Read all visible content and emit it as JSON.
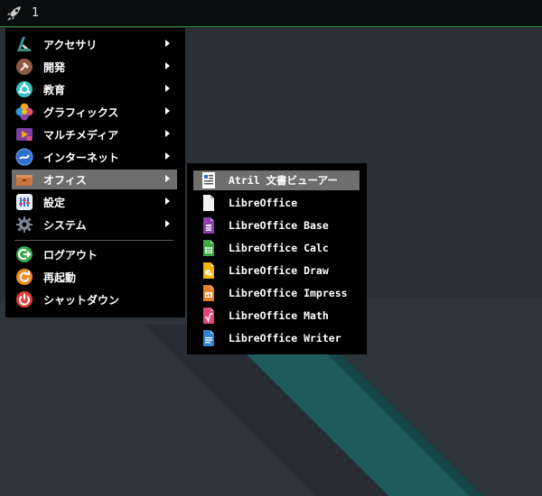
{
  "panel": {
    "workspace": "1"
  },
  "main_menu": {
    "items": [
      {
        "label": "アクセサリ",
        "icon": "accessories-icon",
        "submenu": true
      },
      {
        "label": "開発",
        "icon": "development-icon",
        "submenu": true
      },
      {
        "label": "教育",
        "icon": "education-icon",
        "submenu": true
      },
      {
        "label": "グラフィックス",
        "icon": "graphics-icon",
        "submenu": true
      },
      {
        "label": "マルチメディア",
        "icon": "multimedia-icon",
        "submenu": true
      },
      {
        "label": "インターネット",
        "icon": "internet-icon",
        "submenu": true
      },
      {
        "label": "オフィス",
        "icon": "office-icon",
        "submenu": true,
        "active": true
      },
      {
        "label": "設定",
        "icon": "settings-icon",
        "submenu": true
      },
      {
        "label": "システム",
        "icon": "system-icon",
        "submenu": true
      }
    ],
    "session": [
      {
        "label": "ログアウト",
        "icon": "logout-icon"
      },
      {
        "label": "再起動",
        "icon": "reboot-icon"
      },
      {
        "label": "シャットダウン",
        "icon": "shutdown-icon"
      }
    ]
  },
  "office_menu": {
    "items": [
      {
        "label": "Atril 文書ビューアー",
        "icon": "document-viewer-icon",
        "active": true
      },
      {
        "label": "LibreOffice",
        "icon": "libreoffice-icon"
      },
      {
        "label": "LibreOffice Base",
        "icon": "libreoffice-base-icon"
      },
      {
        "label": "LibreOffice Calc",
        "icon": "libreoffice-calc-icon"
      },
      {
        "label": "LibreOffice Draw",
        "icon": "libreoffice-draw-icon"
      },
      {
        "label": "LibreOffice Impress",
        "icon": "libreoffice-impress-icon"
      },
      {
        "label": "LibreOffice Math",
        "icon": "libreoffice-math-icon"
      },
      {
        "label": "LibreOffice Writer",
        "icon": "libreoffice-writer-icon"
      }
    ]
  },
  "colors": {
    "panel_border": "#1f8a3c",
    "highlight": "#6e6e6e",
    "desktop_stripe": "#1f5a5c",
    "desktop_bg": "#2a3036"
  }
}
